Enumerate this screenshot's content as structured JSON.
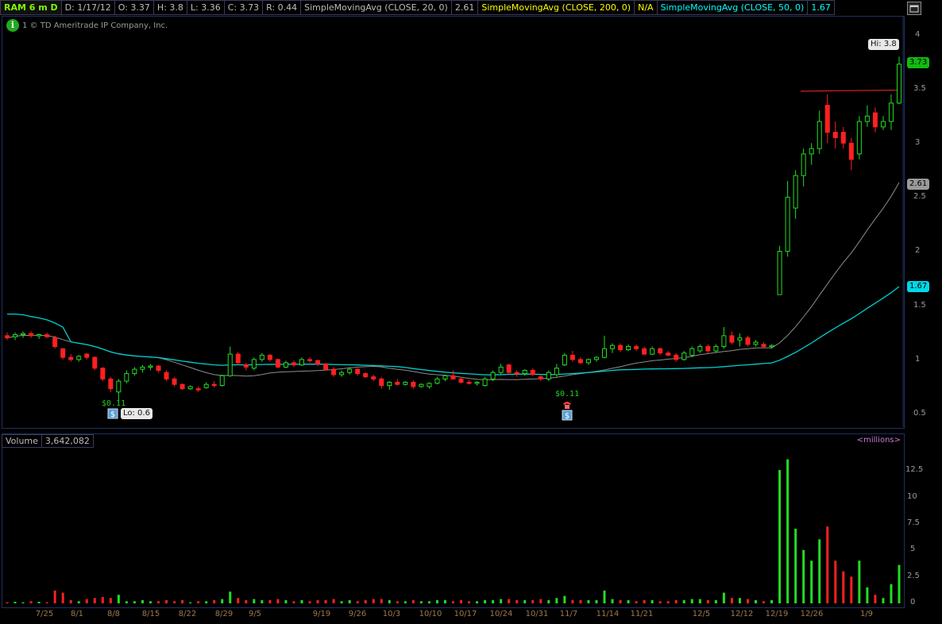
{
  "header": {
    "symbol": "RAM 6 m D",
    "date": "D: 1/17/12",
    "open": "O: 3.37",
    "high": "H: 3.8",
    "low": "L: 3.36",
    "close": "C: 3.73",
    "range": "R: 0.44",
    "sma20_label": "SimpleMovingAvg (CLOSE, 20, 0)",
    "sma20_value": "2.61",
    "sma200_label": "SimpleMovingAvg (CLOSE, 200, 0)",
    "sma200_value": "N/A",
    "sma50_label": "SimpleMovingAvg (CLOSE, 50, 0)",
    "sma50_value": "1.67"
  },
  "copyright": "1 © TD Ameritrade IP Company, Inc.",
  "price_axis": [
    "4",
    "3.5",
    "3",
    "2.5",
    "2",
    "1.5",
    "1",
    "0.5"
  ],
  "tags": {
    "hi": "Hi: 3.8",
    "lo": "Lo: 0.6",
    "last": "3.73",
    "sma20": "2.61",
    "sma50": "1.67",
    "dividend1": "$0.11",
    "dividend2": "$0.11"
  },
  "volume": {
    "label": "Volume",
    "value": "3,642,082",
    "units": "<millions>",
    "axis": [
      "12.5",
      "10",
      "7.5",
      "5",
      "2.5",
      "0"
    ]
  },
  "x_axis": [
    "7/25",
    "8/1",
    "8/8",
    "8/15",
    "8/22",
    "8/29",
    "9/5",
    "9/19",
    "9/26",
    "10/3",
    "10/10",
    "10/17",
    "10/24",
    "10/31",
    "11/7",
    "11/14",
    "11/21",
    "12/5",
    "12/12",
    "12/19",
    "12/26",
    "1/9"
  ],
  "colors": {
    "up": "#22dd22",
    "down": "#ff2020",
    "sma20": "#8c8c8c",
    "sma50": "#00d0d0",
    "resist": "#cc2222"
  },
  "chart_data": {
    "type": "candlestick",
    "title": "RAM 6 m D",
    "ylim": [
      0.4,
      4.1
    ],
    "volume_ylim": [
      0,
      14
    ],
    "candles": [
      {
        "o": 1.22,
        "h": 1.25,
        "l": 1.18,
        "c": 1.2,
        "v": 0.1
      },
      {
        "o": 1.21,
        "h": 1.25,
        "l": 1.18,
        "c": 1.23,
        "v": 0.15
      },
      {
        "o": 1.23,
        "h": 1.26,
        "l": 1.2,
        "c": 1.24,
        "v": 0.1
      },
      {
        "o": 1.24,
        "h": 1.26,
        "l": 1.2,
        "c": 1.22,
        "v": 0.2
      },
      {
        "o": 1.22,
        "h": 1.24,
        "l": 1.19,
        "c": 1.23,
        "v": 0.15
      },
      {
        "o": 1.23,
        "h": 1.25,
        "l": 1.2,
        "c": 1.21,
        "v": 0.1
      },
      {
        "o": 1.2,
        "h": 1.22,
        "l": 1.1,
        "c": 1.12,
        "v": 1.2
      },
      {
        "o": 1.1,
        "h": 1.1,
        "l": 1.0,
        "c": 1.02,
        "v": 1.0
      },
      {
        "o": 1.02,
        "h": 1.05,
        "l": 0.98,
        "c": 1.0,
        "v": 0.3
      },
      {
        "o": 1.0,
        "h": 1.04,
        "l": 0.98,
        "c": 1.03,
        "v": 0.2
      },
      {
        "o": 1.05,
        "h": 1.06,
        "l": 1.0,
        "c": 1.02,
        "v": 0.4
      },
      {
        "o": 1.02,
        "h": 1.03,
        "l": 0.9,
        "c": 0.92,
        "v": 0.5
      },
      {
        "o": 0.92,
        "h": 0.93,
        "l": 0.8,
        "c": 0.82,
        "v": 0.6
      },
      {
        "o": 0.82,
        "h": 0.84,
        "l": 0.7,
        "c": 0.73,
        "v": 0.5
      },
      {
        "o": 0.7,
        "h": 0.82,
        "l": 0.6,
        "c": 0.8,
        "v": 0.8
      },
      {
        "o": 0.8,
        "h": 0.9,
        "l": 0.78,
        "c": 0.87,
        "v": 0.2
      },
      {
        "o": 0.87,
        "h": 0.93,
        "l": 0.85,
        "c": 0.91,
        "v": 0.2
      },
      {
        "o": 0.91,
        "h": 0.95,
        "l": 0.88,
        "c": 0.93,
        "v": 0.3
      },
      {
        "o": 0.93,
        "h": 0.96,
        "l": 0.9,
        "c": 0.94,
        "v": 0.2
      },
      {
        "o": 0.94,
        "h": 0.95,
        "l": 0.88,
        "c": 0.9,
        "v": 0.2
      },
      {
        "o": 0.88,
        "h": 0.9,
        "l": 0.8,
        "c": 0.82,
        "v": 0.3
      },
      {
        "o": 0.82,
        "h": 0.84,
        "l": 0.75,
        "c": 0.77,
        "v": 0.2
      },
      {
        "o": 0.77,
        "h": 0.78,
        "l": 0.72,
        "c": 0.73,
        "v": 0.3
      },
      {
        "o": 0.73,
        "h": 0.76,
        "l": 0.72,
        "c": 0.75,
        "v": 0.1
      },
      {
        "o": 0.73,
        "h": 0.75,
        "l": 0.7,
        "c": 0.72,
        "v": 0.2
      },
      {
        "o": 0.74,
        "h": 0.79,
        "l": 0.73,
        "c": 0.77,
        "v": 0.2
      },
      {
        "o": 0.77,
        "h": 0.8,
        "l": 0.74,
        "c": 0.76,
        "v": 0.3
      },
      {
        "o": 0.76,
        "h": 0.86,
        "l": 0.75,
        "c": 0.85,
        "v": 0.4
      },
      {
        "o": 0.85,
        "h": 1.12,
        "l": 0.84,
        "c": 1.05,
        "v": 1.1
      },
      {
        "o": 1.05,
        "h": 1.07,
        "l": 0.95,
        "c": 0.97,
        "v": 0.5
      },
      {
        "o": 0.95,
        "h": 0.97,
        "l": 0.9,
        "c": 0.93,
        "v": 0.3
      },
      {
        "o": 0.92,
        "h": 1.02,
        "l": 0.9,
        "c": 1.0,
        "v": 0.4
      },
      {
        "o": 1.0,
        "h": 1.06,
        "l": 0.98,
        "c": 1.04,
        "v": 0.3
      },
      {
        "o": 1.04,
        "h": 1.05,
        "l": 0.98,
        "c": 1.0,
        "v": 0.3
      },
      {
        "o": 1.0,
        "h": 1.01,
        "l": 0.92,
        "c": 0.93,
        "v": 0.4
      },
      {
        "o": 0.93,
        "h": 0.99,
        "l": 0.92,
        "c": 0.97,
        "v": 0.3
      },
      {
        "o": 0.97,
        "h": 0.99,
        "l": 0.93,
        "c": 0.95,
        "v": 0.2
      },
      {
        "o": 0.95,
        "h": 1.02,
        "l": 0.94,
        "c": 1.0,
        "v": 0.3
      },
      {
        "o": 1.0,
        "h": 1.02,
        "l": 0.97,
        "c": 0.99,
        "v": 0.2
      },
      {
        "o": 0.99,
        "h": 1.0,
        "l": 0.94,
        "c": 0.96,
        "v": 0.3
      },
      {
        "o": 0.96,
        "h": 0.97,
        "l": 0.9,
        "c": 0.91,
        "v": 0.3
      },
      {
        "o": 0.91,
        "h": 0.93,
        "l": 0.84,
        "c": 0.86,
        "v": 0.4
      },
      {
        "o": 0.86,
        "h": 0.9,
        "l": 0.84,
        "c": 0.88,
        "v": 0.2
      },
      {
        "o": 0.88,
        "h": 0.93,
        "l": 0.86,
        "c": 0.91,
        "v": 0.3
      },
      {
        "o": 0.91,
        "h": 0.92,
        "l": 0.85,
        "c": 0.87,
        "v": 0.2
      },
      {
        "o": 0.87,
        "h": 0.88,
        "l": 0.83,
        "c": 0.84,
        "v": 0.3
      },
      {
        "o": 0.84,
        "h": 0.86,
        "l": 0.8,
        "c": 0.82,
        "v": 0.4
      },
      {
        "o": 0.82,
        "h": 0.84,
        "l": 0.73,
        "c": 0.76,
        "v": 0.4
      },
      {
        "o": 0.76,
        "h": 0.8,
        "l": 0.72,
        "c": 0.79,
        "v": 0.3
      },
      {
        "o": 0.79,
        "h": 0.82,
        "l": 0.76,
        "c": 0.77,
        "v": 0.2
      },
      {
        "o": 0.77,
        "h": 0.8,
        "l": 0.76,
        "c": 0.79,
        "v": 0.2
      },
      {
        "o": 0.79,
        "h": 0.81,
        "l": 0.73,
        "c": 0.75,
        "v": 0.3
      },
      {
        "o": 0.75,
        "h": 0.78,
        "l": 0.74,
        "c": 0.77,
        "v": 0.2
      },
      {
        "o": 0.75,
        "h": 0.79,
        "l": 0.73,
        "c": 0.78,
        "v": 0.2
      },
      {
        "o": 0.78,
        "h": 0.84,
        "l": 0.77,
        "c": 0.82,
        "v": 0.3
      },
      {
        "o": 0.82,
        "h": 0.86,
        "l": 0.8,
        "c": 0.85,
        "v": 0.3
      },
      {
        "o": 0.85,
        "h": 0.9,
        "l": 0.83,
        "c": 0.82,
        "v": 0.2
      },
      {
        "o": 0.82,
        "h": 0.83,
        "l": 0.78,
        "c": 0.79,
        "v": 0.3
      },
      {
        "o": 0.79,
        "h": 0.81,
        "l": 0.77,
        "c": 0.78,
        "v": 0.2
      },
      {
        "o": 0.78,
        "h": 0.8,
        "l": 0.76,
        "c": 0.79,
        "v": 0.2
      },
      {
        "o": 0.76,
        "h": 0.84,
        "l": 0.75,
        "c": 0.82,
        "v": 0.3
      },
      {
        "o": 0.82,
        "h": 0.9,
        "l": 0.8,
        "c": 0.88,
        "v": 0.3
      },
      {
        "o": 0.88,
        "h": 0.96,
        "l": 0.86,
        "c": 0.93,
        "v": 0.4
      },
      {
        "o": 0.95,
        "h": 0.96,
        "l": 0.87,
        "c": 0.88,
        "v": 0.4
      },
      {
        "o": 0.88,
        "h": 0.9,
        "l": 0.84,
        "c": 0.87,
        "v": 0.3
      },
      {
        "o": 0.87,
        "h": 0.91,
        "l": 0.85,
        "c": 0.9,
        "v": 0.3
      },
      {
        "o": 0.9,
        "h": 0.92,
        "l": 0.85,
        "c": 0.86,
        "v": 0.3
      },
      {
        "o": 0.84,
        "h": 0.86,
        "l": 0.8,
        "c": 0.82,
        "v": 0.4
      },
      {
        "o": 0.82,
        "h": 0.9,
        "l": 0.8,
        "c": 0.88,
        "v": 0.3
      },
      {
        "o": 0.86,
        "h": 0.96,
        "l": 0.84,
        "c": 0.92,
        "v": 0.5
      },
      {
        "o": 0.95,
        "h": 1.06,
        "l": 0.94,
        "c": 1.04,
        "v": 0.7
      },
      {
        "o": 1.04,
        "h": 1.08,
        "l": 0.98,
        "c": 1.0,
        "v": 0.3
      },
      {
        "o": 1.0,
        "h": 1.02,
        "l": 0.96,
        "c": 0.97,
        "v": 0.3
      },
      {
        "o": 0.97,
        "h": 1.01,
        "l": 0.95,
        "c": 1.0,
        "v": 0.3
      },
      {
        "o": 1.0,
        "h": 1.03,
        "l": 0.98,
        "c": 1.02,
        "v": 0.3
      },
      {
        "o": 1.02,
        "h": 1.22,
        "l": 1.01,
        "c": 1.1,
        "v": 1.2
      },
      {
        "o": 1.1,
        "h": 1.15,
        "l": 1.06,
        "c": 1.13,
        "v": 0.4
      },
      {
        "o": 1.13,
        "h": 1.15,
        "l": 1.07,
        "c": 1.09,
        "v": 0.3
      },
      {
        "o": 1.09,
        "h": 1.14,
        "l": 1.08,
        "c": 1.12,
        "v": 0.3
      },
      {
        "o": 1.12,
        "h": 1.14,
        "l": 1.08,
        "c": 1.1,
        "v": 0.2
      },
      {
        "o": 1.1,
        "h": 1.12,
        "l": 1.04,
        "c": 1.05,
        "v": 0.3
      },
      {
        "o": 1.05,
        "h": 1.12,
        "l": 1.04,
        "c": 1.1,
        "v": 0.3
      },
      {
        "o": 1.1,
        "h": 1.11,
        "l": 1.04,
        "c": 1.06,
        "v": 0.2
      },
      {
        "o": 1.06,
        "h": 1.08,
        "l": 1.03,
        "c": 1.04,
        "v": 0.2
      },
      {
        "o": 1.04,
        "h": 1.06,
        "l": 0.98,
        "c": 1.0,
        "v": 0.3
      },
      {
        "o": 1.0,
        "h": 1.08,
        "l": 0.99,
        "c": 1.06,
        "v": 0.3
      },
      {
        "o": 1.04,
        "h": 1.12,
        "l": 1.02,
        "c": 1.1,
        "v": 0.4
      },
      {
        "o": 1.08,
        "h": 1.14,
        "l": 1.06,
        "c": 1.12,
        "v": 0.4
      },
      {
        "o": 1.12,
        "h": 1.14,
        "l": 1.06,
        "c": 1.08,
        "v": 0.3
      },
      {
        "o": 1.08,
        "h": 1.14,
        "l": 1.06,
        "c": 1.12,
        "v": 0.3
      },
      {
        "o": 1.12,
        "h": 1.3,
        "l": 1.1,
        "c": 1.22,
        "v": 1.0
      },
      {
        "o": 1.22,
        "h": 1.26,
        "l": 1.14,
        "c": 1.16,
        "v": 0.5
      },
      {
        "o": 1.18,
        "h": 1.24,
        "l": 1.12,
        "c": 1.2,
        "v": 0.5
      },
      {
        "o": 1.2,
        "h": 1.22,
        "l": 1.12,
        "c": 1.14,
        "v": 0.4
      },
      {
        "o": 1.14,
        "h": 1.18,
        "l": 1.12,
        "c": 1.16,
        "v": 0.3
      },
      {
        "o": 1.14,
        "h": 1.16,
        "l": 1.1,
        "c": 1.12,
        "v": 0.2
      },
      {
        "o": 1.12,
        "h": 1.14,
        "l": 1.1,
        "c": 1.13,
        "v": 0.3
      },
      {
        "o": 1.6,
        "h": 2.05,
        "l": 1.65,
        "c": 2.0,
        "v": 12.5
      },
      {
        "o": 2.0,
        "h": 2.65,
        "l": 1.95,
        "c": 2.5,
        "v": 13.5
      },
      {
        "o": 2.4,
        "h": 2.75,
        "l": 2.3,
        "c": 2.7,
        "v": 7.0
      },
      {
        "o": 2.7,
        "h": 2.95,
        "l": 2.6,
        "c": 2.9,
        "v": 5.0
      },
      {
        "o": 2.9,
        "h": 3.0,
        "l": 2.8,
        "c": 2.95,
        "v": 4.0
      },
      {
        "o": 2.95,
        "h": 3.3,
        "l": 2.9,
        "c": 3.2,
        "v": 6.0
      },
      {
        "o": 3.35,
        "h": 3.45,
        "l": 3.0,
        "c": 3.1,
        "v": 7.2
      },
      {
        "o": 3.1,
        "h": 3.2,
        "l": 2.95,
        "c": 3.05,
        "v": 4.0
      },
      {
        "o": 3.1,
        "h": 3.15,
        "l": 2.95,
        "c": 3.0,
        "v": 3.0
      },
      {
        "o": 3.0,
        "h": 3.05,
        "l": 2.75,
        "c": 2.85,
        "v": 2.5
      },
      {
        "o": 2.9,
        "h": 3.25,
        "l": 2.85,
        "c": 3.2,
        "v": 4.0
      },
      {
        "o": 3.2,
        "h": 3.35,
        "l": 3.15,
        "c": 3.25,
        "v": 1.5
      },
      {
        "o": 3.28,
        "h": 3.33,
        "l": 3.1,
        "c": 3.15,
        "v": 0.8
      },
      {
        "o": 3.15,
        "h": 3.25,
        "l": 3.12,
        "c": 3.2,
        "v": 0.5
      },
      {
        "o": 3.2,
        "h": 3.45,
        "l": 3.12,
        "c": 3.37,
        "v": 1.8
      },
      {
        "o": 3.37,
        "h": 3.8,
        "l": 3.36,
        "c": 3.73,
        "v": 3.6
      }
    ]
  }
}
